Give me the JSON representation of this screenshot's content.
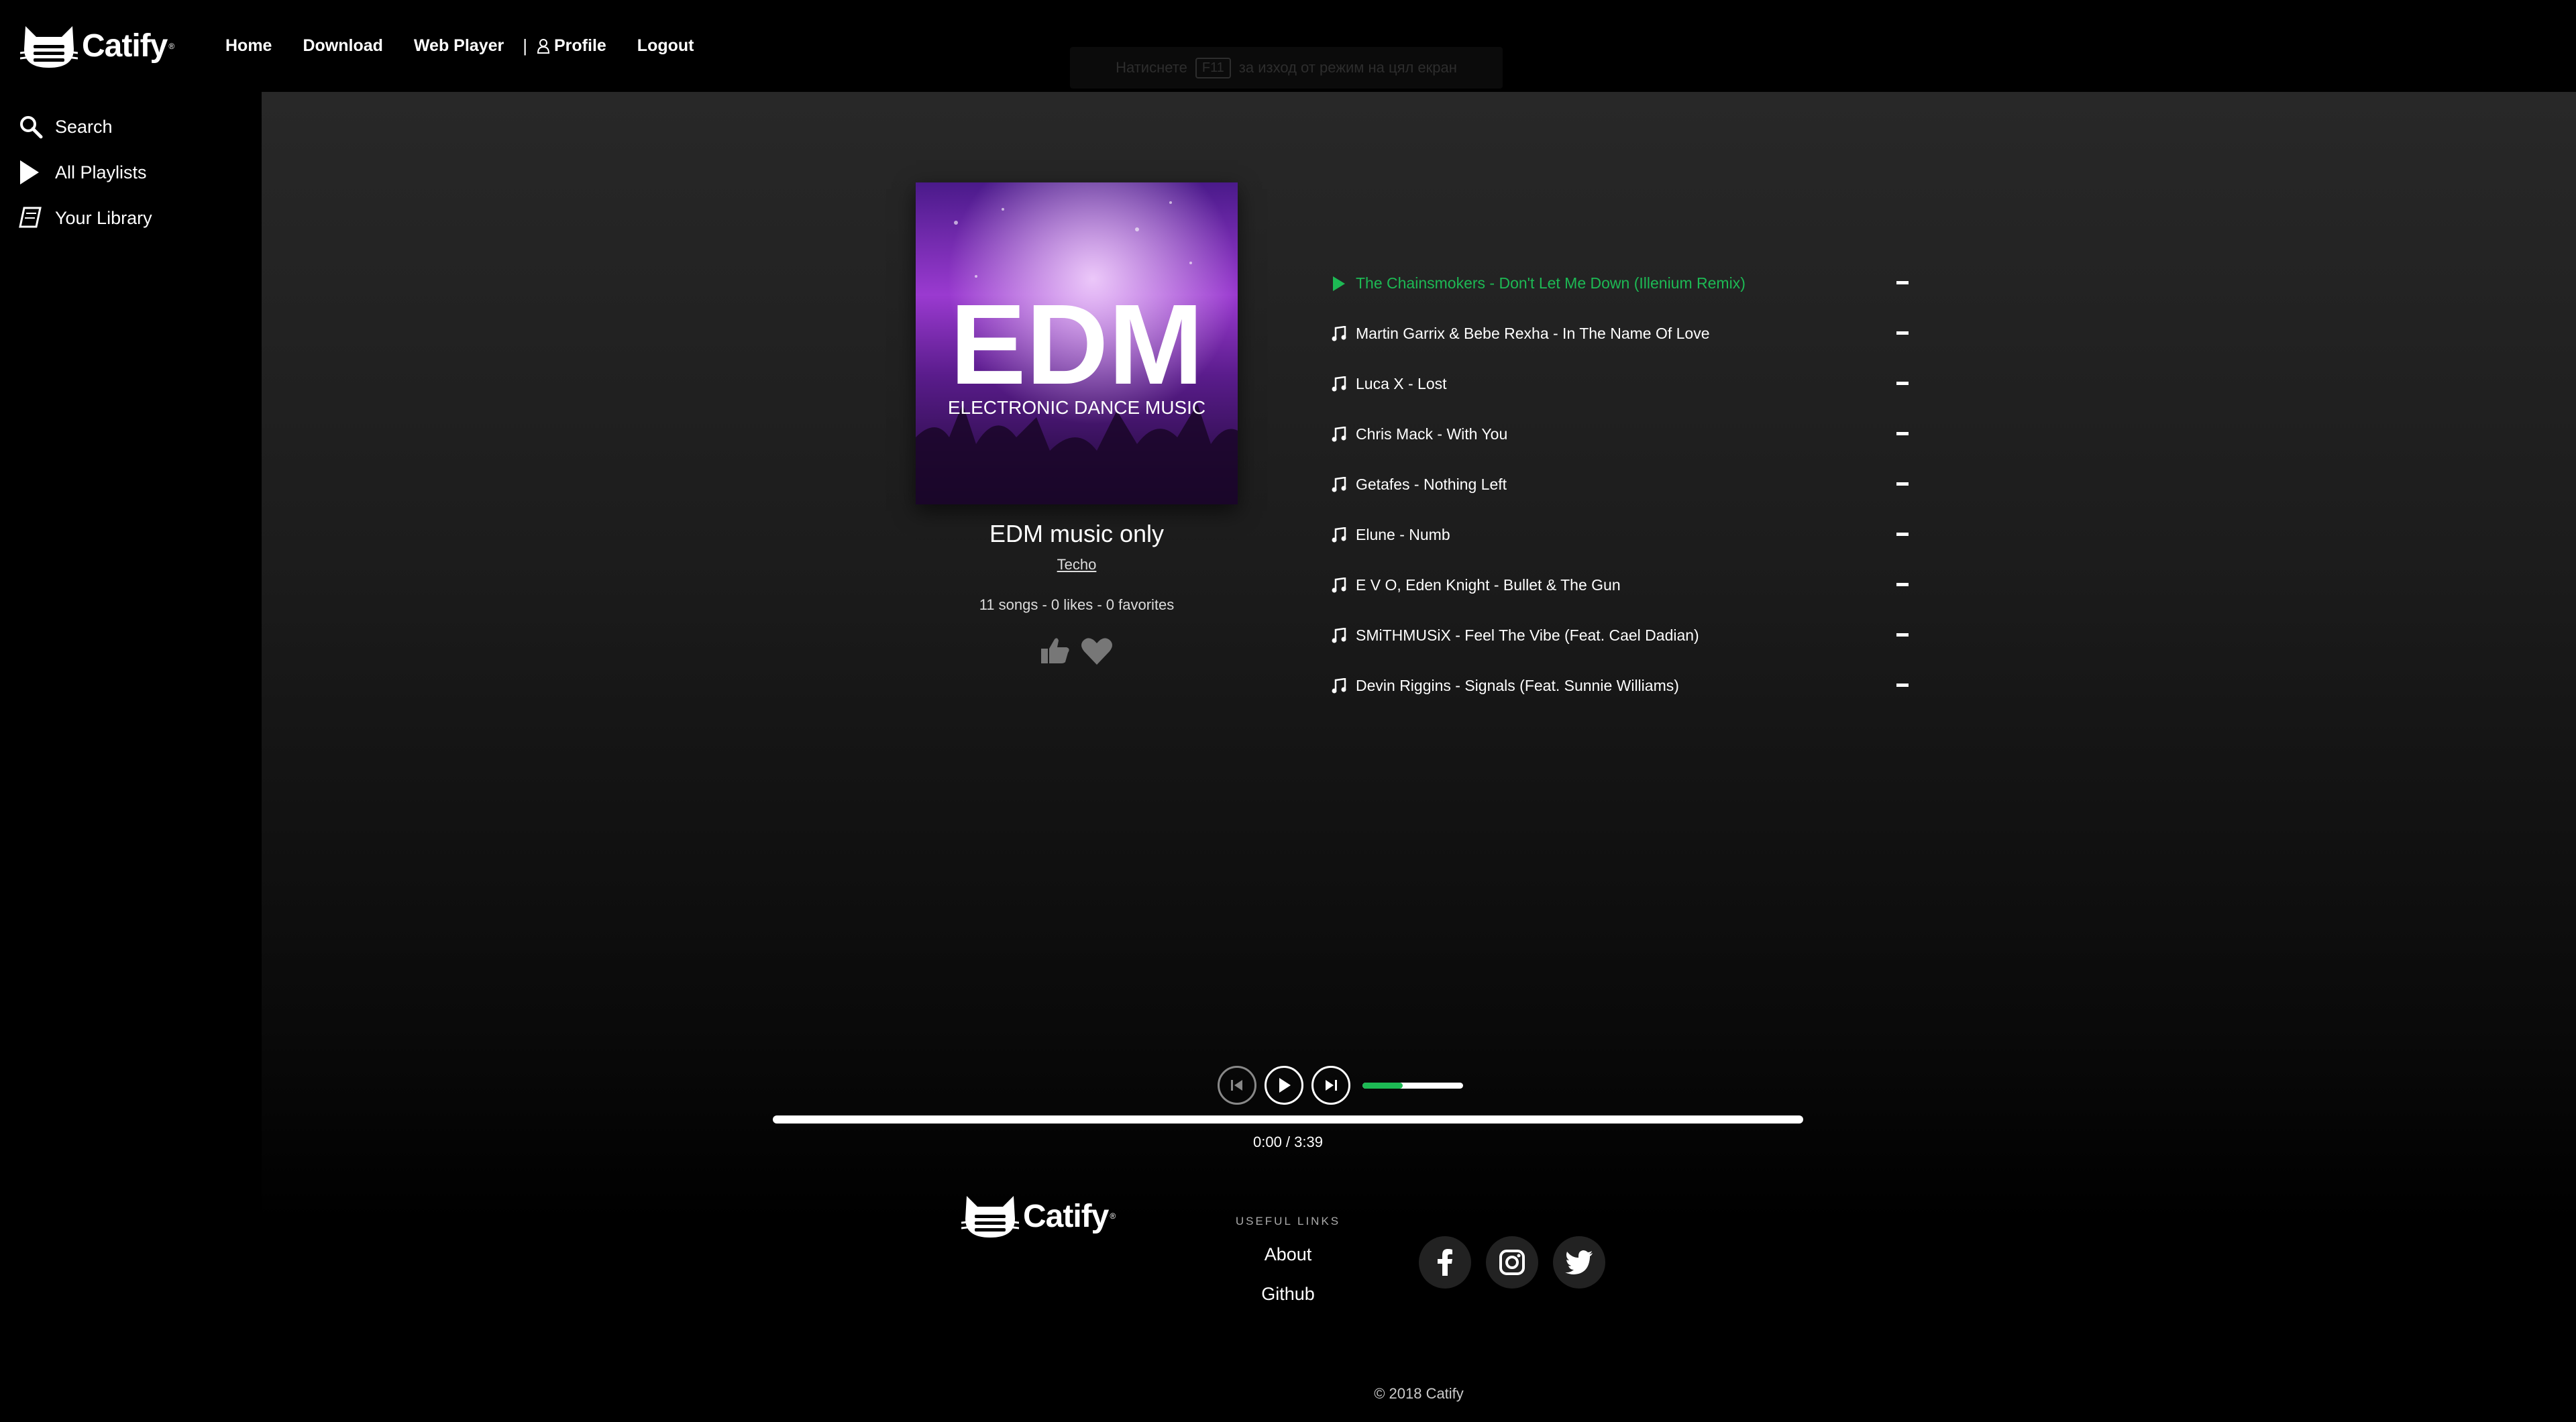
{
  "brand": {
    "name": "Catify",
    "reg": "®"
  },
  "nav": {
    "home": "Home",
    "download": "Download",
    "web_player": "Web Player",
    "separator": "|",
    "profile": "Profile",
    "logout": "Logout"
  },
  "hint": {
    "before": "Натиснете",
    "key": "F11",
    "after": "за изход от режим на цял екран"
  },
  "sidebar": {
    "items": [
      {
        "label": "Search",
        "icon": "search-icon"
      },
      {
        "label": "All Playlists",
        "icon": "play-icon"
      },
      {
        "label": "Your Library",
        "icon": "book-icon"
      }
    ]
  },
  "playlist": {
    "cover": {
      "big": "EDM",
      "small": "ELECTRONIC DANCE MUSIC"
    },
    "title": "EDM music only",
    "genre": "Techo",
    "stats": "11 songs - 0 likes - 0 favorites",
    "actions": [
      {
        "icon": "thumbs-up-icon"
      },
      {
        "icon": "heart-icon"
      }
    ]
  },
  "tracks": [
    {
      "title": "The Chainsmokers - Don't Let Me Down (Illenium Remix)",
      "playing": true
    },
    {
      "title": "Martin Garrix & Bebe Rexha - In The Name Of Love",
      "playing": false
    },
    {
      "title": "Luca X - Lost",
      "playing": false
    },
    {
      "title": "Chris Mack - With You",
      "playing": false
    },
    {
      "title": "Getafes - Nothing Left",
      "playing": false
    },
    {
      "title": "Elune - Numb",
      "playing": false
    },
    {
      "title": "E V O, Eden Knight - Bullet & The Gun",
      "playing": false
    },
    {
      "title": "SMiTHMUSiX - Feel The Vibe (Feat. Cael Dadian)",
      "playing": false
    },
    {
      "title": "Devin Riggins - Signals (Feat. Sunnie Williams)",
      "playing": false
    }
  ],
  "player": {
    "time": "0:00 / 3:39",
    "progress_fraction": 0.0,
    "volume_fraction": 0.4
  },
  "footer": {
    "useful_links_heading": "USEFUL LINKS",
    "links": [
      "About",
      "Github"
    ],
    "social": [
      {
        "icon": "facebook-icon"
      },
      {
        "icon": "instagram-icon"
      },
      {
        "icon": "twitter-icon"
      }
    ],
    "copyright": "© 2018 Catify"
  },
  "colors": {
    "accent": "#1db954",
    "background": "#000000",
    "main_gradient_top": "#282828"
  }
}
